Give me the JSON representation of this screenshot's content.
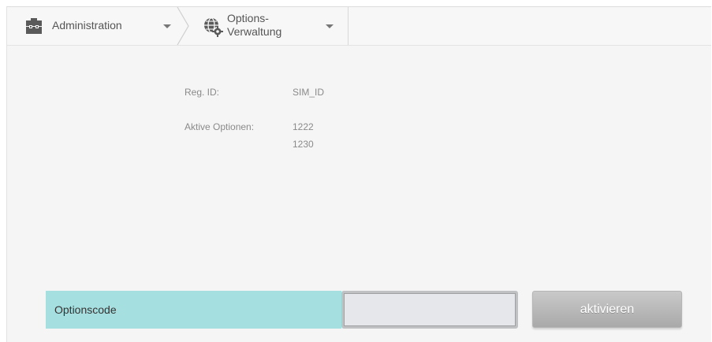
{
  "breadcrumb": {
    "items": [
      {
        "label": "Administration",
        "icon": "briefcase-icon"
      },
      {
        "label": "Options-\nVerwaltung",
        "icon": "globe-gear-icon"
      }
    ]
  },
  "info": {
    "reg_id_label": "Reg. ID:",
    "reg_id_value": "SIM_ID",
    "active_options_label": "Aktive Optionen:",
    "active_options": [
      "1222",
      "1230"
    ]
  },
  "form": {
    "code_label": "Optionscode",
    "code_value": "",
    "activate_label": "aktivieren"
  },
  "colors": {
    "label_bg": "#a6dfe0",
    "button_bg": "#b8b8b8"
  }
}
